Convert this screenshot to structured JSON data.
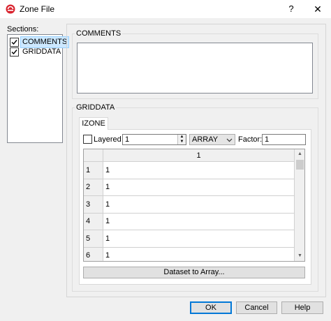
{
  "window": {
    "title": "Zone File",
    "help_glyph": "?",
    "close_glyph": "✕"
  },
  "sections": {
    "label": "Sections:",
    "items": [
      {
        "label": "COMMENTS",
        "checked": true,
        "selected": true
      },
      {
        "label": "GRIDDATA",
        "checked": true,
        "selected": false
      }
    ]
  },
  "comments": {
    "group_title": "COMMENTS",
    "text": ""
  },
  "griddata": {
    "group_title": "GRIDDATA",
    "tab_label": "IZONE",
    "layered_label": "Layered",
    "layered_checked": false,
    "layer_value": "1",
    "array_mode": "ARRAY",
    "factor_label": "Factor:",
    "factor_value": "1",
    "column_header": "1",
    "rows": [
      {
        "num": "1",
        "val": "1"
      },
      {
        "num": "2",
        "val": "1"
      },
      {
        "num": "3",
        "val": "1"
      },
      {
        "num": "4",
        "val": "1"
      },
      {
        "num": "5",
        "val": "1"
      },
      {
        "num": "6",
        "val": "1"
      }
    ],
    "dataset_button": "Dataset to Array..."
  },
  "footer": {
    "ok": "OK",
    "cancel": "Cancel",
    "help": "Help"
  },
  "colors": {
    "app_icon": "#d9242f",
    "selection": "#cce8ff",
    "default_button_border": "#0078d7"
  },
  "icons": {
    "app": "app-logo-icon",
    "spin_up": "caret-up-icon",
    "spin_down": "caret-down-icon",
    "combo": "chevron-down-icon",
    "check": "checkmark-icon"
  }
}
